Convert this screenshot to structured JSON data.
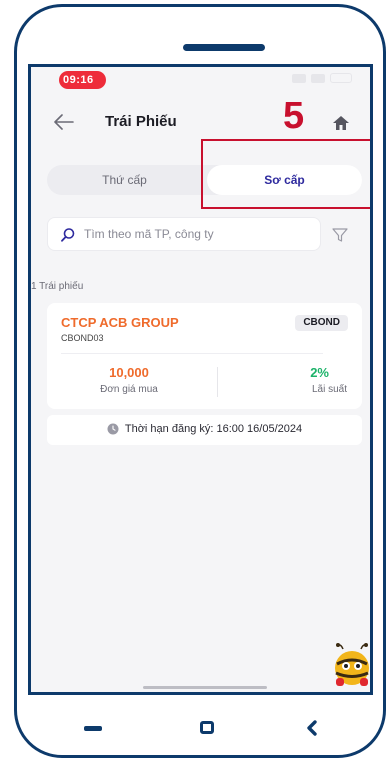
{
  "status_bar": {
    "time": "09:16"
  },
  "header": {
    "title": "Trái Phiếu",
    "step_number": "5"
  },
  "tabs": [
    {
      "label": "Thứ cấp",
      "active": false
    },
    {
      "label": "Sơ cấp",
      "active": true
    }
  ],
  "search": {
    "placeholder": "Tìm theo mã TP, công ty"
  },
  "results": {
    "count_label": "1 Trái phiếu"
  },
  "bond": {
    "company": "CTCP ACB GROUP",
    "code": "CBOND03",
    "tag": "CBOND",
    "price_value": "10,000",
    "price_label": "Đơn giá mua",
    "rate_value": "2%",
    "rate_label": "Lãi suất",
    "deadline": "Thời hạn đăng ký: 16:00 16/05/2024"
  },
  "colors": {
    "accent": "#2e2a9e",
    "orange": "#ef6b2c",
    "green": "#1db36a",
    "highlight": "#c8102e",
    "frame": "#0d3a6b"
  },
  "icons": [
    "back-arrow-icon",
    "home-icon",
    "search-icon",
    "filter-icon",
    "clock-icon",
    "mascot-bee-icon"
  ]
}
